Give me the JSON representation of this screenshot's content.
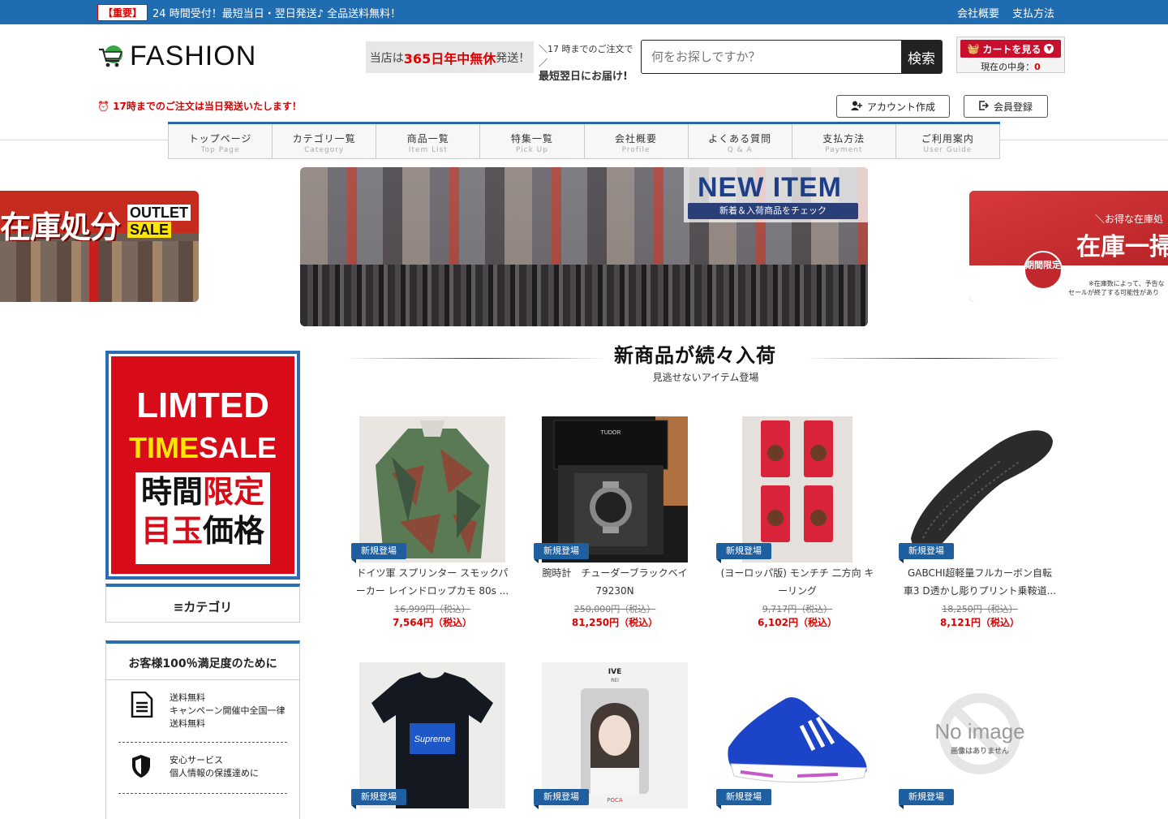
{
  "topbar": {
    "badge": "【重要】",
    "message": "24 時間受付！最短当日・翌日発送♪ 全品送料無料！",
    "links": [
      "会社概要",
      "支払方法"
    ]
  },
  "header": {
    "logo_text": "FASHION",
    "promo1_prefix": "当店は",
    "promo1_highlight": "365日年中無休",
    "promo1_suffix": "発送！",
    "promo2_line1": "＼17 時までのご注文で／",
    "promo2_line2": "最短翌日にお届け!",
    "search_placeholder": "何をお探しですか？",
    "search_button": "検索",
    "cart_button": "カートを見る",
    "cart_count_label": "現在の中身：",
    "cart_count": "0",
    "notice": "⏰ 17時までのご注文は当日発送いたします！",
    "account_create": "アカウント作成",
    "member_login": "会員登録"
  },
  "nav": [
    {
      "jp": "トップページ",
      "en": "Top Page"
    },
    {
      "jp": "カテゴリ一覧",
      "en": "Category"
    },
    {
      "jp": "商品一覧",
      "en": "Item List"
    },
    {
      "jp": "特集一覧",
      "en": "Pick Up"
    },
    {
      "jp": "会社概要",
      "en": "Profile"
    },
    {
      "jp": "よくある質問",
      "en": "Q & A"
    },
    {
      "jp": "支払方法",
      "en": "Payment"
    },
    {
      "jp": "ご利用案内",
      "en": "User Guide"
    }
  ],
  "banners": {
    "left_big": "在庫処分",
    "left_small1": "OUTLET",
    "left_small2": "SALE",
    "main_title": "NEW ITEM",
    "main_sub": "新着＆入荷商品をチェック",
    "right_sub": "＼お得な在庫処",
    "right_big": "在庫一掃",
    "right_circle": "期間限定",
    "right_note1": "※在庫数によって、予告な",
    "right_note2": "セールが終了する可能性があり"
  },
  "sidebar": {
    "sale_line1": "LIMTED",
    "sale_line2a": "TIME",
    "sale_line2b": "SALE",
    "sale_jp1a": "時間",
    "sale_jp1b": "限定",
    "sale_jp2a": "目玉",
    "sale_jp2b": "価格",
    "category_label": "≡カテゴリ",
    "sat_title": "お客様100％満足度のために",
    "sat_items": [
      {
        "text": "送料無料\nキャンペーン開催中全国一律送料無料"
      },
      {
        "text": "安心サービス\n個人情報の保護達めに"
      }
    ]
  },
  "section": {
    "title": "新商品が続々入荷",
    "subtitle": "見逃せないアイテム登場"
  },
  "products": [
    {
      "tag": "新規登場",
      "name": "ドイツ軍 スプリンター スモックパーカー レインドロップカモ 80s ...",
      "old_price": "16,999円（税込）",
      "new_price": "7,564円（税込）"
    },
    {
      "tag": "新規登場",
      "name": "腕時計　チューダーブラックベイ 79230N",
      "old_price": "250,000円（税込）",
      "new_price": "81,250円（税込）"
    },
    {
      "tag": "新規登場",
      "name": "(ヨーロッパ版) モンチチ 二方向 キーリング",
      "old_price": "9,717円（税込）",
      "new_price": "6,102円（税込）"
    },
    {
      "tag": "新規登場",
      "name": "GABCHI超軽量フルカーボン自転車3 D透かし彫りプリント乗鞍道...",
      "old_price": "18,250円（税込）",
      "new_price": "8,121円（税込）"
    },
    {
      "tag": "新規登場"
    },
    {
      "tag": "新規登場",
      "card_title": "IVE",
      "card_sub": "REI",
      "card_brand": "POCA"
    },
    {
      "tag": "新規登場"
    },
    {
      "tag": "新規登場",
      "noimage_title": "No image",
      "noimage_sub": "画像はありません"
    }
  ],
  "colors": {
    "accent": "#1f6cb0",
    "sale_red": "#d70c18",
    "price_red": "#dd0000"
  }
}
